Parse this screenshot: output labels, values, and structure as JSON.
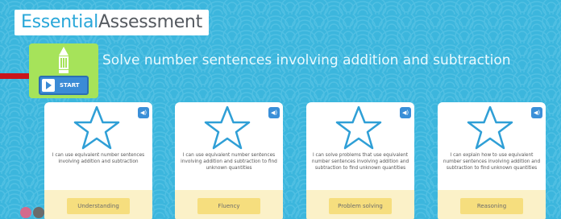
{
  "logo": {
    "part1": "Essential",
    "part2": "Assessment"
  },
  "activity": {
    "title": "Solve number sentences involving addition and subtraction",
    "start_label": "START"
  },
  "cards": [
    {
      "statement": "I can use equivalent number sentences involving addition and subtraction",
      "skill": "Understanding"
    },
    {
      "statement": "I can use equivalent number sentences involving addition and subtraction to find unknown quantities",
      "skill": "Fluency"
    },
    {
      "statement": "I can solve problems that use equivalent number sentences involving addition and subtraction to find unknown quantities",
      "skill": "Problem solving"
    },
    {
      "statement": "I can explain how to use equivalent number sentences involving addition and subtraction to find unknown quantities",
      "skill": "Reasoning"
    }
  ],
  "colors": {
    "background": "#3cb6dd",
    "start_tile": "#a6e35a",
    "start_button": "#3b8bd6",
    "skill_button": "#f6de7e",
    "arrow": "#c9151b"
  }
}
